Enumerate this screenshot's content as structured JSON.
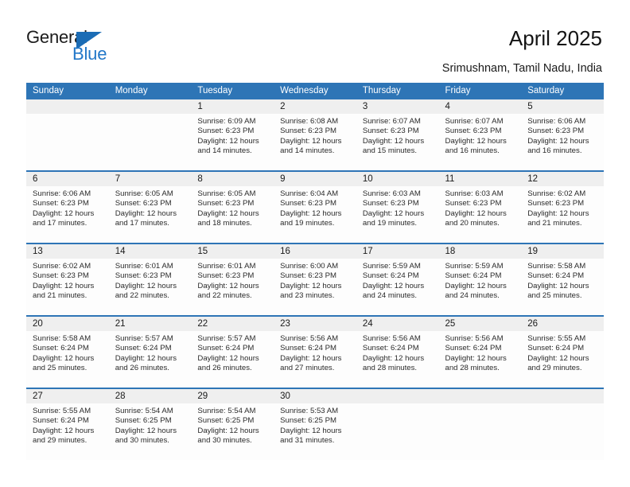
{
  "brand": {
    "name_primary": "General",
    "name_secondary": "Blue",
    "accent_color": "#2277c8",
    "triangle_color": "#1b6cb5"
  },
  "header": {
    "title": "April 2025",
    "subtitle": "Srimushnam, Tamil Nadu, India",
    "header_bar_color": "#2e75b6"
  },
  "calendar": {
    "weekday_headers": [
      "Sunday",
      "Monday",
      "Tuesday",
      "Wednesday",
      "Thursday",
      "Friday",
      "Saturday"
    ],
    "weeks": [
      [
        {
          "day": "",
          "sunrise": "",
          "sunset": "",
          "daylight_line1": "",
          "daylight_line2": "",
          "empty": true
        },
        {
          "day": "",
          "sunrise": "",
          "sunset": "",
          "daylight_line1": "",
          "daylight_line2": "",
          "empty": true
        },
        {
          "day": "1",
          "sunrise": "Sunrise: 6:09 AM",
          "sunset": "Sunset: 6:23 PM",
          "daylight_line1": "Daylight: 12 hours",
          "daylight_line2": "and 14 minutes."
        },
        {
          "day": "2",
          "sunrise": "Sunrise: 6:08 AM",
          "sunset": "Sunset: 6:23 PM",
          "daylight_line1": "Daylight: 12 hours",
          "daylight_line2": "and 14 minutes."
        },
        {
          "day": "3",
          "sunrise": "Sunrise: 6:07 AM",
          "sunset": "Sunset: 6:23 PM",
          "daylight_line1": "Daylight: 12 hours",
          "daylight_line2": "and 15 minutes."
        },
        {
          "day": "4",
          "sunrise": "Sunrise: 6:07 AM",
          "sunset": "Sunset: 6:23 PM",
          "daylight_line1": "Daylight: 12 hours",
          "daylight_line2": "and 16 minutes."
        },
        {
          "day": "5",
          "sunrise": "Sunrise: 6:06 AM",
          "sunset": "Sunset: 6:23 PM",
          "daylight_line1": "Daylight: 12 hours",
          "daylight_line2": "and 16 minutes."
        }
      ],
      [
        {
          "day": "6",
          "sunrise": "Sunrise: 6:06 AM",
          "sunset": "Sunset: 6:23 PM",
          "daylight_line1": "Daylight: 12 hours",
          "daylight_line2": "and 17 minutes."
        },
        {
          "day": "7",
          "sunrise": "Sunrise: 6:05 AM",
          "sunset": "Sunset: 6:23 PM",
          "daylight_line1": "Daylight: 12 hours",
          "daylight_line2": "and 17 minutes."
        },
        {
          "day": "8",
          "sunrise": "Sunrise: 6:05 AM",
          "sunset": "Sunset: 6:23 PM",
          "daylight_line1": "Daylight: 12 hours",
          "daylight_line2": "and 18 minutes."
        },
        {
          "day": "9",
          "sunrise": "Sunrise: 6:04 AM",
          "sunset": "Sunset: 6:23 PM",
          "daylight_line1": "Daylight: 12 hours",
          "daylight_line2": "and 19 minutes."
        },
        {
          "day": "10",
          "sunrise": "Sunrise: 6:03 AM",
          "sunset": "Sunset: 6:23 PM",
          "daylight_line1": "Daylight: 12 hours",
          "daylight_line2": "and 19 minutes."
        },
        {
          "day": "11",
          "sunrise": "Sunrise: 6:03 AM",
          "sunset": "Sunset: 6:23 PM",
          "daylight_line1": "Daylight: 12 hours",
          "daylight_line2": "and 20 minutes."
        },
        {
          "day": "12",
          "sunrise": "Sunrise: 6:02 AM",
          "sunset": "Sunset: 6:23 PM",
          "daylight_line1": "Daylight: 12 hours",
          "daylight_line2": "and 21 minutes."
        }
      ],
      [
        {
          "day": "13",
          "sunrise": "Sunrise: 6:02 AM",
          "sunset": "Sunset: 6:23 PM",
          "daylight_line1": "Daylight: 12 hours",
          "daylight_line2": "and 21 minutes."
        },
        {
          "day": "14",
          "sunrise": "Sunrise: 6:01 AM",
          "sunset": "Sunset: 6:23 PM",
          "daylight_line1": "Daylight: 12 hours",
          "daylight_line2": "and 22 minutes."
        },
        {
          "day": "15",
          "sunrise": "Sunrise: 6:01 AM",
          "sunset": "Sunset: 6:23 PM",
          "daylight_line1": "Daylight: 12 hours",
          "daylight_line2": "and 22 minutes."
        },
        {
          "day": "16",
          "sunrise": "Sunrise: 6:00 AM",
          "sunset": "Sunset: 6:23 PM",
          "daylight_line1": "Daylight: 12 hours",
          "daylight_line2": "and 23 minutes."
        },
        {
          "day": "17",
          "sunrise": "Sunrise: 5:59 AM",
          "sunset": "Sunset: 6:24 PM",
          "daylight_line1": "Daylight: 12 hours",
          "daylight_line2": "and 24 minutes."
        },
        {
          "day": "18",
          "sunrise": "Sunrise: 5:59 AM",
          "sunset": "Sunset: 6:24 PM",
          "daylight_line1": "Daylight: 12 hours",
          "daylight_line2": "and 24 minutes."
        },
        {
          "day": "19",
          "sunrise": "Sunrise: 5:58 AM",
          "sunset": "Sunset: 6:24 PM",
          "daylight_line1": "Daylight: 12 hours",
          "daylight_line2": "and 25 minutes."
        }
      ],
      [
        {
          "day": "20",
          "sunrise": "Sunrise: 5:58 AM",
          "sunset": "Sunset: 6:24 PM",
          "daylight_line1": "Daylight: 12 hours",
          "daylight_line2": "and 25 minutes."
        },
        {
          "day": "21",
          "sunrise": "Sunrise: 5:57 AM",
          "sunset": "Sunset: 6:24 PM",
          "daylight_line1": "Daylight: 12 hours",
          "daylight_line2": "and 26 minutes."
        },
        {
          "day": "22",
          "sunrise": "Sunrise: 5:57 AM",
          "sunset": "Sunset: 6:24 PM",
          "daylight_line1": "Daylight: 12 hours",
          "daylight_line2": "and 26 minutes."
        },
        {
          "day": "23",
          "sunrise": "Sunrise: 5:56 AM",
          "sunset": "Sunset: 6:24 PM",
          "daylight_line1": "Daylight: 12 hours",
          "daylight_line2": "and 27 minutes."
        },
        {
          "day": "24",
          "sunrise": "Sunrise: 5:56 AM",
          "sunset": "Sunset: 6:24 PM",
          "daylight_line1": "Daylight: 12 hours",
          "daylight_line2": "and 28 minutes."
        },
        {
          "day": "25",
          "sunrise": "Sunrise: 5:56 AM",
          "sunset": "Sunset: 6:24 PM",
          "daylight_line1": "Daylight: 12 hours",
          "daylight_line2": "and 28 minutes."
        },
        {
          "day": "26",
          "sunrise": "Sunrise: 5:55 AM",
          "sunset": "Sunset: 6:24 PM",
          "daylight_line1": "Daylight: 12 hours",
          "daylight_line2": "and 29 minutes."
        }
      ],
      [
        {
          "day": "27",
          "sunrise": "Sunrise: 5:55 AM",
          "sunset": "Sunset: 6:24 PM",
          "daylight_line1": "Daylight: 12 hours",
          "daylight_line2": "and 29 minutes."
        },
        {
          "day": "28",
          "sunrise": "Sunrise: 5:54 AM",
          "sunset": "Sunset: 6:25 PM",
          "daylight_line1": "Daylight: 12 hours",
          "daylight_line2": "and 30 minutes."
        },
        {
          "day": "29",
          "sunrise": "Sunrise: 5:54 AM",
          "sunset": "Sunset: 6:25 PM",
          "daylight_line1": "Daylight: 12 hours",
          "daylight_line2": "and 30 minutes."
        },
        {
          "day": "30",
          "sunrise": "Sunrise: 5:53 AM",
          "sunset": "Sunset: 6:25 PM",
          "daylight_line1": "Daylight: 12 hours",
          "daylight_line2": "and 31 minutes."
        },
        {
          "day": "",
          "sunrise": "",
          "sunset": "",
          "daylight_line1": "",
          "daylight_line2": "",
          "empty": true
        },
        {
          "day": "",
          "sunrise": "",
          "sunset": "",
          "daylight_line1": "",
          "daylight_line2": "",
          "empty": true
        },
        {
          "day": "",
          "sunrise": "",
          "sunset": "",
          "daylight_line1": "",
          "daylight_line2": "",
          "empty": true
        }
      ]
    ]
  }
}
